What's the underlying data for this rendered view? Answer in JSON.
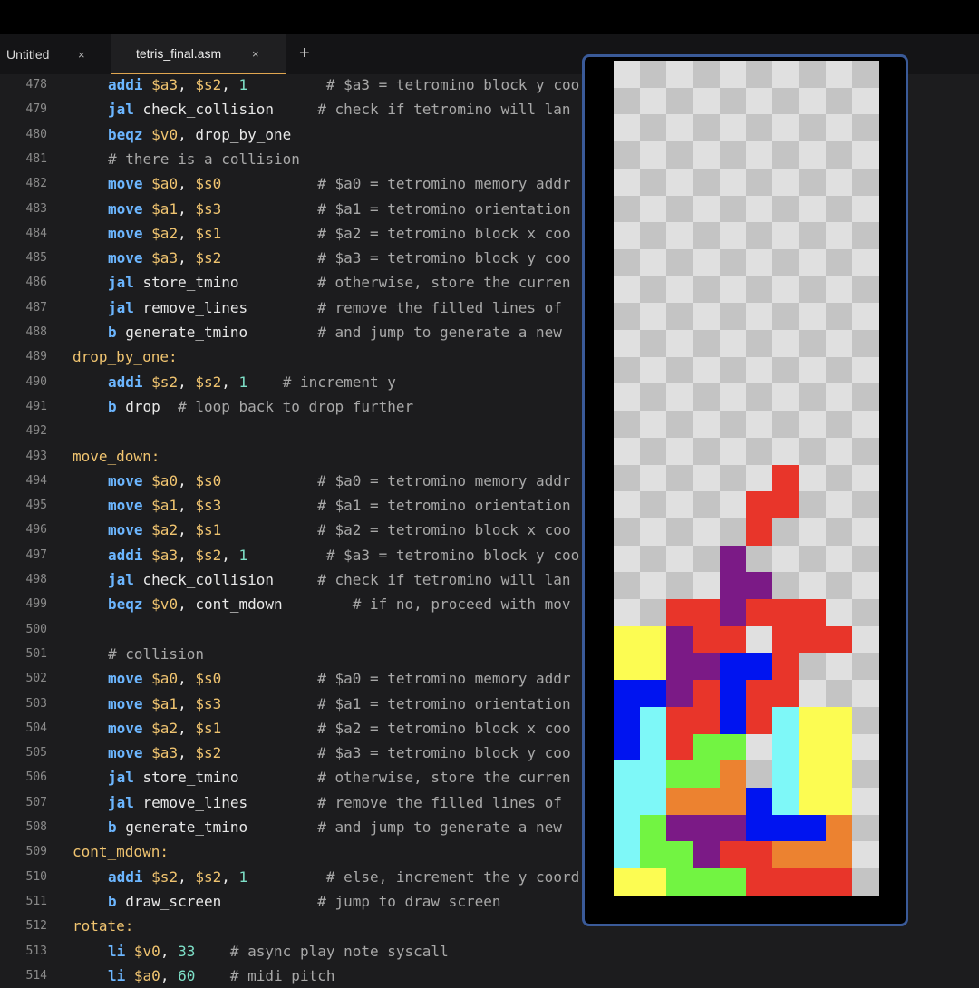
{
  "tabs": [
    {
      "label": "Untitled",
      "close": "×",
      "active": false
    },
    {
      "label": "tetris_final.asm",
      "close": "×",
      "active": true
    }
  ],
  "new_tab_label": "+",
  "colors": {
    "keyword": "#6cb6ff",
    "register": "#f0c470",
    "number": "#7ee0c8",
    "label": "#f0c470",
    "comment": "#a8a8a8",
    "active_tab_underline": "#e0a650",
    "game_border": "#3a5a98"
  },
  "code_lines": [
    {
      "n": "478",
      "segs": [
        [
          "kw",
          "addi "
        ],
        [
          "reg",
          "$a3"
        ],
        [
          "",
          ""
        ],
        [
          "",
          ", "
        ],
        [
          "reg",
          "$s2"
        ],
        [
          "",
          ", "
        ],
        [
          "num",
          "1"
        ],
        [
          "",
          "         "
        ],
        [
          "com",
          "# $a3 = tetromino block y coo"
        ]
      ],
      "indent": 1
    },
    {
      "n": "479",
      "segs": [
        [
          "kw",
          "jal "
        ],
        [
          "",
          "check_collision     "
        ],
        [
          "com",
          "# check if tetromino will lan"
        ]
      ],
      "indent": 1
    },
    {
      "n": "480",
      "segs": [
        [
          "kw",
          "beqz "
        ],
        [
          "reg",
          "$v0"
        ],
        [
          "",
          ", drop_by_one"
        ]
      ],
      "indent": 1
    },
    {
      "n": "481",
      "segs": [
        [
          "com",
          "# there is a collision"
        ]
      ],
      "indent": 1
    },
    {
      "n": "482",
      "segs": [
        [
          "kw",
          "move "
        ],
        [
          "reg",
          "$a0"
        ],
        [
          "",
          ", "
        ],
        [
          "reg",
          "$s0"
        ],
        [
          "",
          "           "
        ],
        [
          "com",
          "# $a0 = tetromino memory addr"
        ]
      ],
      "indent": 1
    },
    {
      "n": "483",
      "segs": [
        [
          "kw",
          "move "
        ],
        [
          "reg",
          "$a1"
        ],
        [
          "",
          ", "
        ],
        [
          "reg",
          "$s3"
        ],
        [
          "",
          "           "
        ],
        [
          "com",
          "# $a1 = tetromino orientation"
        ]
      ],
      "indent": 1
    },
    {
      "n": "484",
      "segs": [
        [
          "kw",
          "move "
        ],
        [
          "reg",
          "$a2"
        ],
        [
          "",
          ", "
        ],
        [
          "reg",
          "$s1"
        ],
        [
          "",
          "           "
        ],
        [
          "com",
          "# $a2 = tetromino block x coo"
        ]
      ],
      "indent": 1
    },
    {
      "n": "485",
      "segs": [
        [
          "kw",
          "move "
        ],
        [
          "reg",
          "$a3"
        ],
        [
          "",
          ", "
        ],
        [
          "reg",
          "$s2"
        ],
        [
          "",
          "           "
        ],
        [
          "com",
          "# $a3 = tetromino block y coo"
        ]
      ],
      "indent": 1
    },
    {
      "n": "486",
      "segs": [
        [
          "kw",
          "jal "
        ],
        [
          "",
          "store_tmino         "
        ],
        [
          "com",
          "# otherwise, store the curren"
        ]
      ],
      "indent": 1
    },
    {
      "n": "487",
      "segs": [
        [
          "kw",
          "jal "
        ],
        [
          "",
          "remove_lines        "
        ],
        [
          "com",
          "# remove the filled lines of "
        ]
      ],
      "indent": 1
    },
    {
      "n": "488",
      "segs": [
        [
          "kw",
          "b "
        ],
        [
          "",
          "generate_tmino        "
        ],
        [
          "com",
          "# and jump to generate a new "
        ]
      ],
      "indent": 1
    },
    {
      "n": "489",
      "segs": [
        [
          "lab",
          "drop_by_one:"
        ]
      ],
      "indent": 0
    },
    {
      "n": "490",
      "segs": [
        [
          "kw",
          "addi "
        ],
        [
          "reg",
          "$s2"
        ],
        [
          "",
          ", "
        ],
        [
          "reg",
          "$s2"
        ],
        [
          "",
          ", "
        ],
        [
          "num",
          "1"
        ],
        [
          "",
          "    "
        ],
        [
          "com",
          "# increment y"
        ]
      ],
      "indent": 1
    },
    {
      "n": "491",
      "segs": [
        [
          "kw",
          "b "
        ],
        [
          "",
          "drop  "
        ],
        [
          "com",
          "# loop back to drop further"
        ]
      ],
      "indent": 1
    },
    {
      "n": "492",
      "segs": [],
      "indent": 0
    },
    {
      "n": "493",
      "segs": [
        [
          "lab",
          "move_down:"
        ]
      ],
      "indent": 0
    },
    {
      "n": "494",
      "segs": [
        [
          "kw",
          "move "
        ],
        [
          "reg",
          "$a0"
        ],
        [
          "",
          ", "
        ],
        [
          "reg",
          "$s0"
        ],
        [
          "",
          "           "
        ],
        [
          "com",
          "# $a0 = tetromino memory addr"
        ]
      ],
      "indent": 1
    },
    {
      "n": "495",
      "segs": [
        [
          "kw",
          "move "
        ],
        [
          "reg",
          "$a1"
        ],
        [
          "",
          ", "
        ],
        [
          "reg",
          "$s3"
        ],
        [
          "",
          "           "
        ],
        [
          "com",
          "# $a1 = tetromino orientation"
        ]
      ],
      "indent": 1
    },
    {
      "n": "496",
      "segs": [
        [
          "kw",
          "move "
        ],
        [
          "reg",
          "$a2"
        ],
        [
          "",
          ", "
        ],
        [
          "reg",
          "$s1"
        ],
        [
          "",
          "           "
        ],
        [
          "com",
          "# $a2 = tetromino block x coo"
        ]
      ],
      "indent": 1
    },
    {
      "n": "497",
      "segs": [
        [
          "kw",
          "addi "
        ],
        [
          "reg",
          "$a3"
        ],
        [
          "",
          ", "
        ],
        [
          "reg",
          "$s2"
        ],
        [
          "",
          ", "
        ],
        [
          "num",
          "1"
        ],
        [
          "",
          "         "
        ],
        [
          "com",
          "# $a3 = tetromino block y coo"
        ]
      ],
      "indent": 1
    },
    {
      "n": "498",
      "segs": [
        [
          "kw",
          "jal "
        ],
        [
          "",
          "check_collision     "
        ],
        [
          "com",
          "# check if tetromino will lan"
        ]
      ],
      "indent": 1
    },
    {
      "n": "499",
      "segs": [
        [
          "kw",
          "beqz "
        ],
        [
          "reg",
          "$v0"
        ],
        [
          "",
          ", cont_mdown        "
        ],
        [
          "com",
          "# if no, proceed with mov"
        ]
      ],
      "indent": 1
    },
    {
      "n": "500",
      "segs": [],
      "indent": 0
    },
    {
      "n": "501",
      "segs": [
        [
          "com",
          "# collision"
        ]
      ],
      "indent": 1
    },
    {
      "n": "502",
      "segs": [
        [
          "kw",
          "move "
        ],
        [
          "reg",
          "$a0"
        ],
        [
          "",
          ", "
        ],
        [
          "reg",
          "$s0"
        ],
        [
          "",
          "           "
        ],
        [
          "com",
          "# $a0 = tetromino memory addr"
        ]
      ],
      "indent": 1
    },
    {
      "n": "503",
      "segs": [
        [
          "kw",
          "move "
        ],
        [
          "reg",
          "$a1"
        ],
        [
          "",
          ", "
        ],
        [
          "reg",
          "$s3"
        ],
        [
          "",
          "           "
        ],
        [
          "com",
          "# $a1 = tetromino orientation"
        ]
      ],
      "indent": 1
    },
    {
      "n": "504",
      "segs": [
        [
          "kw",
          "move "
        ],
        [
          "reg",
          "$a2"
        ],
        [
          "",
          ", "
        ],
        [
          "reg",
          "$s1"
        ],
        [
          "",
          "           "
        ],
        [
          "com",
          "# $a2 = tetromino block x coo"
        ]
      ],
      "indent": 1
    },
    {
      "n": "505",
      "segs": [
        [
          "kw",
          "move "
        ],
        [
          "reg",
          "$a3"
        ],
        [
          "",
          ", "
        ],
        [
          "reg",
          "$s2"
        ],
        [
          "",
          "           "
        ],
        [
          "com",
          "# $a3 = tetromino block y coo"
        ]
      ],
      "indent": 1
    },
    {
      "n": "506",
      "segs": [
        [
          "kw",
          "jal "
        ],
        [
          "",
          "store_tmino         "
        ],
        [
          "com",
          "# otherwise, store the curren"
        ]
      ],
      "indent": 1
    },
    {
      "n": "507",
      "segs": [
        [
          "kw",
          "jal "
        ],
        [
          "",
          "remove_lines        "
        ],
        [
          "com",
          "# remove the filled lines of "
        ]
      ],
      "indent": 1
    },
    {
      "n": "508",
      "segs": [
        [
          "kw",
          "b "
        ],
        [
          "",
          "generate_tmino        "
        ],
        [
          "com",
          "# and jump to generate a new "
        ]
      ],
      "indent": 1
    },
    {
      "n": "509",
      "segs": [
        [
          "lab",
          "cont_mdown:"
        ]
      ],
      "indent": 0
    },
    {
      "n": "510",
      "segs": [
        [
          "kw",
          "addi "
        ],
        [
          "reg",
          "$s2"
        ],
        [
          "",
          ", "
        ],
        [
          "reg",
          "$s2"
        ],
        [
          "",
          ", "
        ],
        [
          "num",
          "1"
        ],
        [
          "",
          "         "
        ],
        [
          "com",
          "# else, increment the y coord"
        ]
      ],
      "indent": 1
    },
    {
      "n": "511",
      "segs": [
        [
          "kw",
          "b "
        ],
        [
          "",
          "draw_screen           "
        ],
        [
          "com",
          "# jump to draw screen"
        ]
      ],
      "indent": 1
    },
    {
      "n": "512",
      "segs": [
        [
          "lab",
          "rotate:"
        ]
      ],
      "indent": 0
    },
    {
      "n": "513",
      "segs": [
        [
          "kw",
          "li "
        ],
        [
          "reg",
          "$v0"
        ],
        [
          "",
          ", "
        ],
        [
          "num",
          "33"
        ],
        [
          "",
          "    "
        ],
        [
          "com",
          "# async play note syscall"
        ]
      ],
      "indent": 1
    },
    {
      "n": "514",
      "segs": [
        [
          "kw",
          "li "
        ],
        [
          "reg",
          "$a0"
        ],
        [
          "",
          ", "
        ],
        [
          "num",
          "60"
        ],
        [
          "",
          "    "
        ],
        [
          "com",
          "# midi pitch"
        ]
      ],
      "indent": 1
    }
  ],
  "board": {
    "cols": 10,
    "rows": 31,
    "palette": {
      "R": "#e8352a",
      "P": "#7b1a86",
      "Y": "#fcfc52",
      "B": "#0014f0",
      "C": "#7ef8f8",
      "G": "#72f442",
      "O": "#ec8230",
      "l": "#e0e0e0",
      "d": "#c4c4c4"
    },
    "cells": [
      "..........",
      "..........",
      "..........",
      "..........",
      "..........",
      "..........",
      "..........",
      "..........",
      "..........",
      "..........",
      "..........",
      "..........",
      "..........",
      "..........",
      "..........",
      "......R...",
      ".....RR...",
      ".....R....",
      "....P.....",
      "....PP....",
      "..RRPRRR..",
      "YYPRRlRRR.",
      "YYPPBBR...",
      "BBPRBRR...",
      "BCRRBRCYY.",
      "BCRGGlCYY.",
      "CCGGOdCYY.",
      "CCOOOBCYY.",
      "CGPPPBBBO.",
      "CGGPRROOO.",
      "YYGGGRRRR."
    ]
  }
}
